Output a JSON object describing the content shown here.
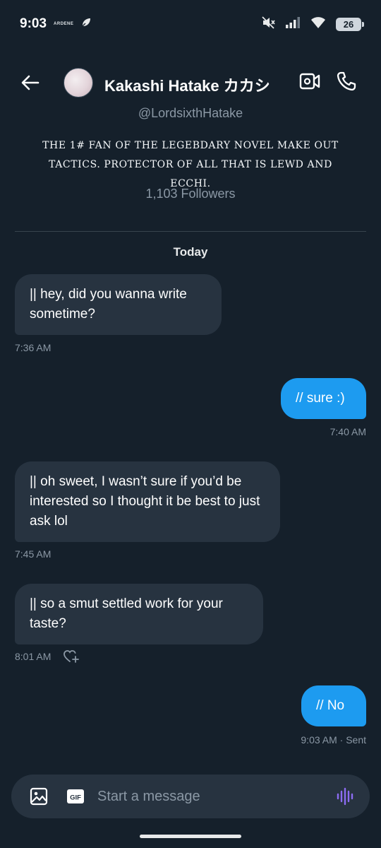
{
  "status_bar": {
    "time": "9:03",
    "carrier_logo_text": "ARDENE",
    "battery_level": "26"
  },
  "header": {
    "name": "Kakashi Hatake カカシ",
    "handle": "@LordsixthHatake",
    "bio": "THE 1# FAN OF THE LEGEBDARY NOVEL MAKE OUT TACTICS. PROTECTOR OF ALL THAT IS LEWD AND ECCHI.",
    "followers": "1,103 Followers"
  },
  "conversation": {
    "day_label": "Today",
    "messages": [
      {
        "direction": "received",
        "text": "|| hey, did you wanna write sometime?",
        "time": "7:36 AM"
      },
      {
        "direction": "sent",
        "text": "// sure :)",
        "time": "7:40 AM"
      },
      {
        "direction": "received",
        "text": "|| oh sweet, I wasn’t sure if you’d be interested so I thought it be best to just ask lol",
        "time": "7:45 AM"
      },
      {
        "direction": "received",
        "text": "|| so a smut settled work for your taste?",
        "time": "8:01 AM"
      },
      {
        "direction": "sent",
        "text": "// No",
        "time": "9:03 AM · Sent"
      }
    ]
  },
  "composer": {
    "placeholder": "Start a message",
    "gif_label": "GIF"
  },
  "colors": {
    "background": "#15202b",
    "received_bubble": "#273340",
    "sent_bubble": "#1d9bf0",
    "secondary_text": "#8b98a5",
    "voice_accent": "#8c6cf2"
  },
  "icons": {
    "status_left": [
      "app-notification-icon"
    ],
    "status_right": [
      "mute-icon",
      "signal-icon",
      "wifi-icon",
      "battery-icon"
    ],
    "header": [
      "back-arrow-icon",
      "video-call-icon",
      "phone-icon"
    ],
    "composer": [
      "image-icon",
      "gif-icon",
      "voice-waveform-icon"
    ],
    "message_actions": [
      "add-reaction-heart-icon"
    ]
  }
}
